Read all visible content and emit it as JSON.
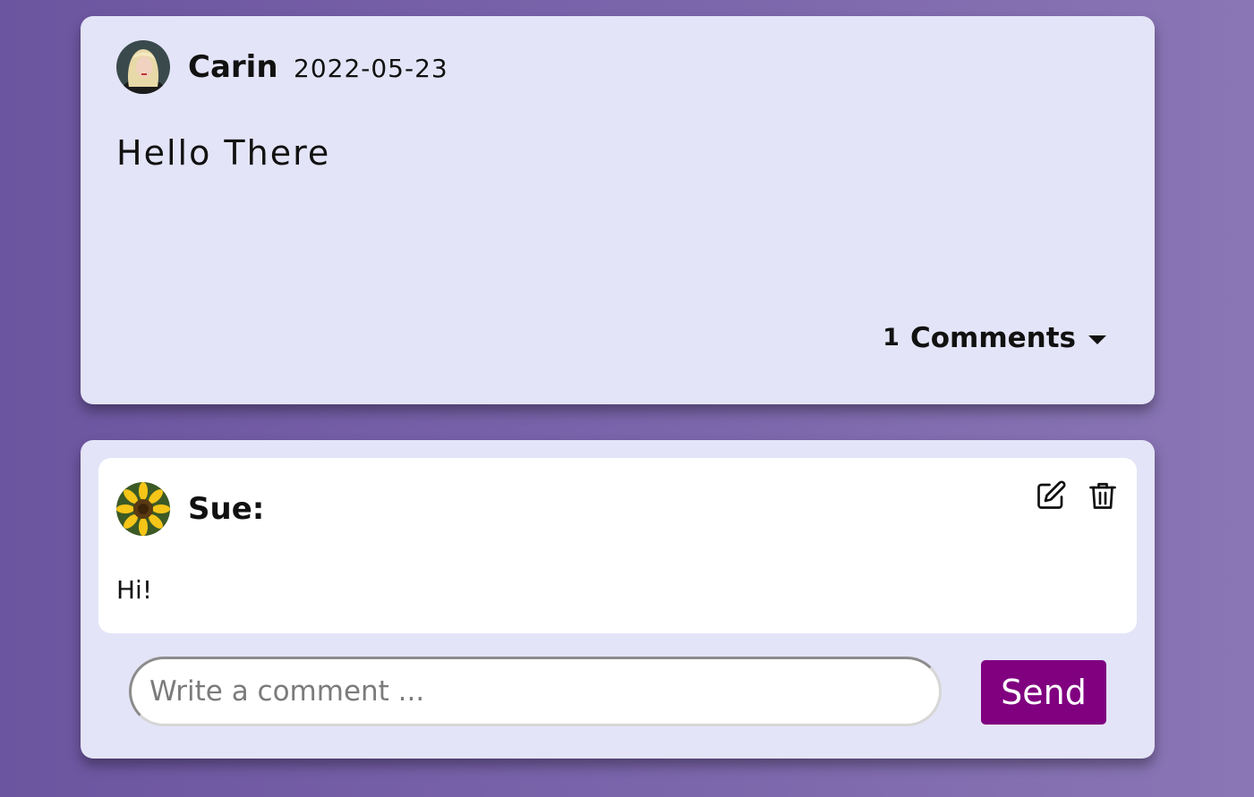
{
  "post": {
    "author": "Carin",
    "date": "2022-05-23",
    "body": "Hello There",
    "comments_count": "1",
    "comments_label": "Comments",
    "avatar_icon": "woman-portrait-avatar"
  },
  "comments": [
    {
      "author": "Sue:",
      "text": "Hi!",
      "avatar_icon": "sunflower-avatar",
      "actions": {
        "edit_icon": "edit-icon",
        "delete_icon": "trash-icon"
      }
    }
  ],
  "comment_form": {
    "placeholder": "Write a comment ...",
    "send_label": "Send"
  },
  "colors": {
    "background": "#7a64aa",
    "card": "#e4e4f8",
    "comment": "#ffffff",
    "send_button": "#800080"
  }
}
